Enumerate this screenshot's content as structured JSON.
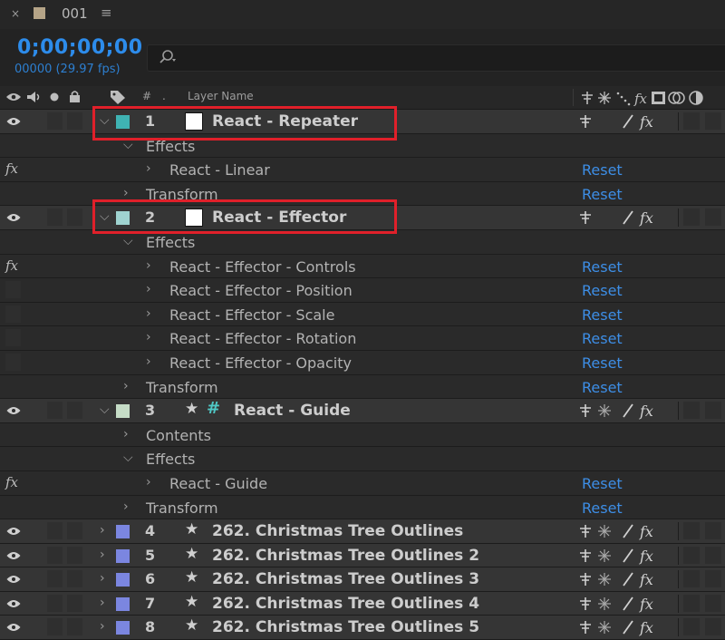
{
  "tab": {
    "title": "001",
    "close_glyph": "×",
    "menu_glyph": "≡",
    "swatch_color": "#b5a487"
  },
  "header": {
    "timecode": "0;00;00;00",
    "fps": "00000 (29.97 fps)"
  },
  "columns": {
    "layer_name": "Layer Name",
    "number": "#"
  },
  "colors": {
    "accent_blue": "#2d8ceb",
    "reset_blue": "#3d8ee6",
    "highlight_red": "#e0202a"
  },
  "rows": [
    {
      "kind": "layer",
      "number": "1",
      "name": "React - Repeater",
      "label_color": "#3fb3b3",
      "source": "solid"
    },
    {
      "kind": "group",
      "name": "Effects"
    },
    {
      "kind": "effect",
      "name": "React - Linear",
      "fx": "fx",
      "reset": "Reset"
    },
    {
      "kind": "group",
      "name": "Transform",
      "reset": "Reset"
    },
    {
      "kind": "layer",
      "number": "2",
      "name": "React - Effector",
      "label_color": "#9fd3d0",
      "source": "solid"
    },
    {
      "kind": "group",
      "name": "Effects"
    },
    {
      "kind": "effect",
      "name": "React - Effector - Controls",
      "fx": "fx",
      "reset": "Reset"
    },
    {
      "kind": "effect",
      "name": "React - Effector - Position",
      "reset": "Reset"
    },
    {
      "kind": "effect",
      "name": "React - Effector - Scale",
      "reset": "Reset"
    },
    {
      "kind": "effect",
      "name": "React - Effector - Rotation",
      "reset": "Reset"
    },
    {
      "kind": "effect",
      "name": "React - Effector - Opacity",
      "reset": "Reset"
    },
    {
      "kind": "group",
      "name": "Transform",
      "reset": "Reset"
    },
    {
      "kind": "layer",
      "number": "3",
      "name": "React - Guide",
      "label_color": "#c5dcc6",
      "source": "guide"
    },
    {
      "kind": "group",
      "name": "Contents"
    },
    {
      "kind": "group",
      "name": "Effects"
    },
    {
      "kind": "effect",
      "name": "React - Guide",
      "fx": "fx",
      "reset": "Reset"
    },
    {
      "kind": "group",
      "name": "Transform",
      "reset": "Reset"
    },
    {
      "kind": "layer",
      "number": "4",
      "name": "262. Christmas Tree Outlines",
      "label_color": "#7b86e0",
      "source": "shape"
    },
    {
      "kind": "layer",
      "number": "5",
      "name": "262. Christmas Tree Outlines 2",
      "label_color": "#7b86e0",
      "source": "shape"
    },
    {
      "kind": "layer",
      "number": "6",
      "name": "262. Christmas Tree Outlines 3",
      "label_color": "#7b86e0",
      "source": "shape"
    },
    {
      "kind": "layer",
      "number": "7",
      "name": "262. Christmas Tree Outlines 4",
      "label_color": "#7b86e0",
      "source": "shape"
    },
    {
      "kind": "layer",
      "number": "8",
      "name": "262. Christmas Tree Outlines 5",
      "label_color": "#7b86e0",
      "source": "shape"
    }
  ]
}
